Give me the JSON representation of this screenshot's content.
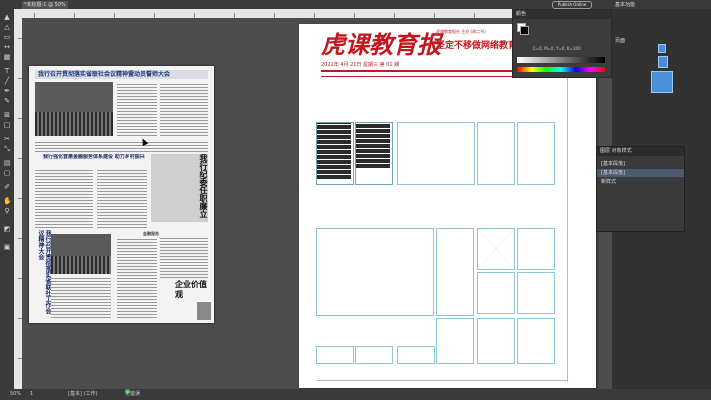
{
  "window": {
    "tab_title": "*未标题-1 @ 50% ×",
    "publish_online": "Publish Online",
    "workspace": "基本功能"
  },
  "tools": [
    "selection",
    "direct-selection",
    "page",
    "gap",
    "content-collector",
    "type",
    "line",
    "pen",
    "pencil",
    "rectangle-frame",
    "rectangle",
    "scissors",
    "free-transform",
    "gradient",
    "note",
    "eyedropper",
    "hand",
    "zoom",
    "fill-stroke",
    "view-mode"
  ],
  "newspaper_image": {
    "headline1": "我行召开贯彻落实省联社会议精神暨动员誓师大会",
    "headline2": "我行强化普惠金融服务体系建设 助力乡村振兴",
    "side_title": "我行纪委任职廉立",
    "headline3": "我行召开贯彻落实省联社工作会议精神大会",
    "section_label": "金融服务",
    "value_text": "企业价值观"
  },
  "page": {
    "masthead": "虎课教育报",
    "top_note": "虎课教育报社 主办 (周二刊)",
    "slogan": "坚定不移做网络教育",
    "dateline": "2021年 4月 21日  星期三  第 01 期"
  },
  "color_panel": {
    "tab": "颜色",
    "values": "C=0, M=0, Y=0, K=100"
  },
  "right_panel": {
    "label": "页面"
  },
  "layers_panel": {
    "tab": "图层  对象样式",
    "group_label": "[基本段落]",
    "selected_item": "[基本段落]",
    "item2": "新样式"
  },
  "statusbar": {
    "zoom": "50%",
    "page": "1",
    "mode": "[基本] (工作)",
    "status": "无错误"
  }
}
